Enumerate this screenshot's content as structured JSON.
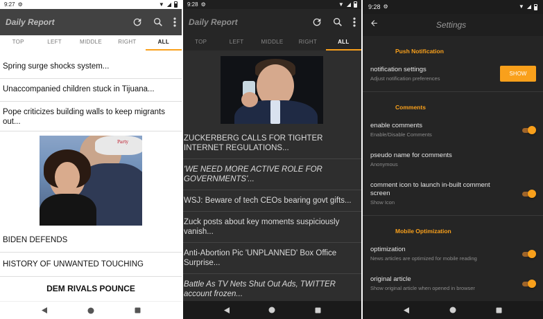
{
  "screen1": {
    "status": {
      "time": "9:27"
    },
    "app_title": "Daily Report",
    "tabs": [
      "TOP",
      "LEFT",
      "MIDDLE",
      "RIGHT",
      "ALL"
    ],
    "active_tab": "ALL",
    "headlines": [
      "Spring surge shocks system...",
      "Unaccompanied children stuck in Tijuana...",
      "Pope criticizes building walls to keep migrants out..."
    ],
    "photo_caption_text": "Party",
    "headlines_after_image": [
      "BIDEN DEFENDS",
      "HISTORY OF UNWANTED TOUCHING",
      "DEM RIVALS POUNCE"
    ]
  },
  "screen2": {
    "status": {
      "time": "9:28"
    },
    "app_title": "Daily Report",
    "tabs": [
      "TOP",
      "LEFT",
      "MIDDLE",
      "RIGHT",
      "ALL"
    ],
    "active_tab": "ALL",
    "headlines": [
      "ZUCKERBERG CALLS FOR TIGHTER INTERNET REGULATIONS...",
      "'WE NEED MORE ACTIVE ROLE FOR GOVERNMENTS'...",
      "WSJ: Beware of tech CEOs bearing govt gifts...",
      "Zuck posts about key moments suspiciously vanish...",
      "Anti-Abortion Pic 'UNPLANNED' Box Office Surprise...",
      "Battle As TV Nets Shut Out Ads, TWITTER account frozen..."
    ]
  },
  "screen3": {
    "status": {
      "time": "9:28"
    },
    "title": "Settings",
    "sections": {
      "push": {
        "title": "Push Notification",
        "notification_settings": {
          "title": "notification settings",
          "subtitle": "Adjust notification preferences",
          "button": "SHOW"
        }
      },
      "comments": {
        "title": "Comments",
        "enable_comments": {
          "title": "enable comments",
          "subtitle": "Enable/Disable Comments",
          "on": true
        },
        "pseudo_name": {
          "title": "pseudo name for comments",
          "subtitle": "Anonymous"
        },
        "comment_icon": {
          "title": "comment icon to launch in-built comment screen",
          "subtitle": "Show Icon",
          "on": true
        }
      },
      "mobile": {
        "title": "Mobile Optimization",
        "optimization": {
          "title": "optimization",
          "subtitle": "News articles are optimized for mobile reading",
          "on": true
        },
        "original_article": {
          "title": "original article",
          "subtitle": "Show original article when opened in browser",
          "on": true
        }
      }
    }
  },
  "colors": {
    "accent": "#f9a01b",
    "appbar_light": "#424242",
    "dark_bg": "#2e2e2e"
  },
  "icons": [
    "refresh-icon",
    "search-icon",
    "more-vert-icon",
    "back-arrow-icon",
    "wifi-icon",
    "signal-icon",
    "battery-icon",
    "settings-gear-icon",
    "nav-back-icon",
    "nav-home-icon",
    "nav-recents-icon"
  ]
}
